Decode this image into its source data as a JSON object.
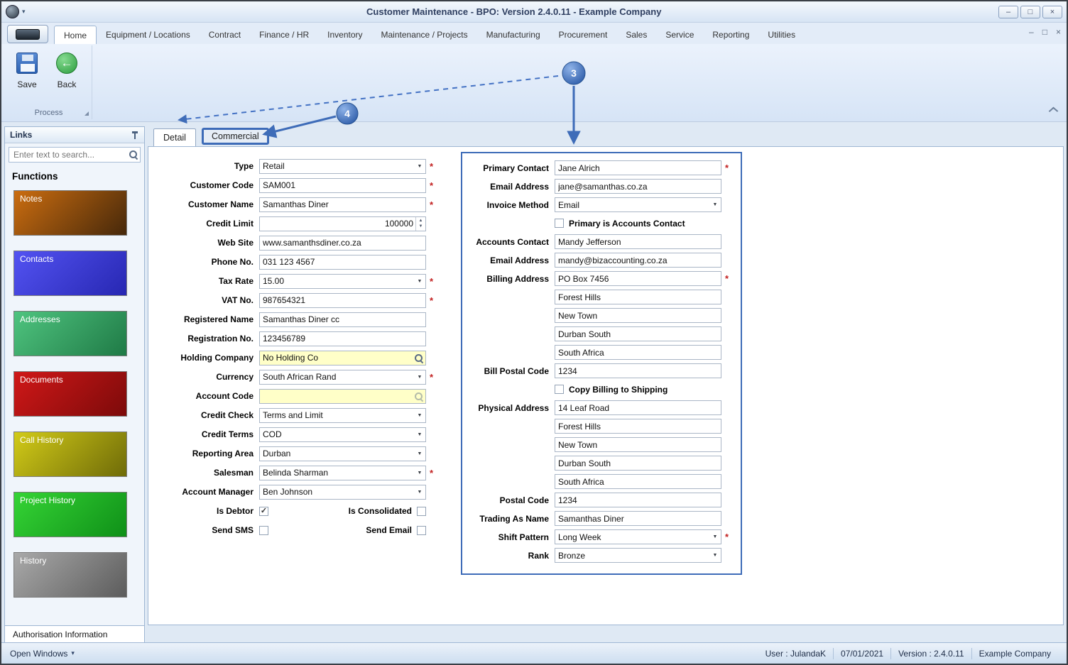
{
  "window": {
    "title": "Customer Maintenance - BPO: Version 2.4.0.11 - Example Company"
  },
  "icons": {
    "minimize": "–",
    "maximize": "□",
    "close": "×",
    "caret_down": "▾",
    "dropdown_arrow": "▼",
    "spin_up": "▲",
    "spin_down": "▼",
    "check": "✓",
    "back_arrow": "←"
  },
  "ribbon": {
    "tabs": [
      "Home",
      "Equipment / Locations",
      "Contract",
      "Finance / HR",
      "Inventory",
      "Maintenance / Projects",
      "Manufacturing",
      "Procurement",
      "Sales",
      "Service",
      "Reporting",
      "Utilities"
    ],
    "active_tab": "Home",
    "save_label": "Save",
    "back_label": "Back",
    "group_label": "Process"
  },
  "sidebar": {
    "title": "Links",
    "search_placeholder": "Enter text to search...",
    "functions_heading": "Functions",
    "items": [
      {
        "label": "Notes",
        "c1": "#cb6d10",
        "c2": "#46280a"
      },
      {
        "label": "Contacts",
        "c1": "#5353f2",
        "c2": "#2727b2"
      },
      {
        "label": "Addresses",
        "c1": "#4fc47f",
        "c2": "#1f7a46"
      },
      {
        "label": "Documents",
        "c1": "#d01818",
        "c2": "#7c0a0a"
      },
      {
        "label": "Call History",
        "c1": "#d2cb18",
        "c2": "#6f6b08"
      },
      {
        "label": "Project History",
        "c1": "#35d435",
        "c2": "#0f9018"
      },
      {
        "label": "History",
        "c1": "#a9a9a9",
        "c2": "#5c5c5c"
      }
    ],
    "footer_tab": "Authorisation Information"
  },
  "main": {
    "tabs": [
      {
        "label": "Detail"
      },
      {
        "label": "Commercial"
      }
    ],
    "left_form": [
      {
        "name": "type",
        "label": "Type",
        "value": "Retail",
        "type": "dropdown",
        "required": true
      },
      {
        "name": "customer-code",
        "label": "Customer Code",
        "value": "SAM001",
        "type": "text",
        "required": true
      },
      {
        "name": "customer-name",
        "label": "Customer Name",
        "value": "Samanthas Diner",
        "type": "text",
        "required": true
      },
      {
        "name": "credit-limit",
        "label": "Credit Limit",
        "value": "100000",
        "type": "spinner"
      },
      {
        "name": "web-site",
        "label": "Web Site",
        "value": "www.samanthsdiner.co.za",
        "type": "text"
      },
      {
        "name": "phone-no",
        "label": "Phone No.",
        "value": "031 123 4567",
        "type": "text"
      },
      {
        "name": "tax-rate",
        "label": "Tax Rate",
        "value": "15.00",
        "type": "dropdown",
        "required": true
      },
      {
        "name": "vat-no",
        "label": "VAT No.",
        "value": "987654321",
        "type": "text",
        "required": true
      },
      {
        "name": "registered-name",
        "label": "Registered Name",
        "value": "Samanthas Diner cc",
        "type": "text"
      },
      {
        "name": "registration-no",
        "label": "Registration No.",
        "value": "123456789",
        "type": "text"
      },
      {
        "name": "holding-company",
        "label": "Holding Company",
        "value": "No Holding Co",
        "type": "lookup",
        "yellow": true
      },
      {
        "name": "currency",
        "label": "Currency",
        "value": "South African Rand",
        "type": "dropdown",
        "required": true
      },
      {
        "name": "account-code",
        "label": "Account Code",
        "value": "",
        "type": "lookup",
        "yellow": true,
        "muted": true
      },
      {
        "name": "credit-check",
        "label": "Credit Check",
        "value": "Terms and Limit",
        "type": "dropdown"
      },
      {
        "name": "credit-terms",
        "label": "Credit Terms",
        "value": "COD",
        "type": "dropdown"
      },
      {
        "name": "reporting-area",
        "label": "Reporting Area",
        "value": "Durban",
        "type": "dropdown"
      },
      {
        "name": "salesman",
        "label": "Salesman",
        "value": "Belinda Sharman",
        "type": "dropdown",
        "required": true
      },
      {
        "name": "account-manager",
        "label": "Account Manager",
        "value": "Ben Johnson",
        "type": "dropdown"
      },
      {
        "name": "debtor-row",
        "type": "checkpair",
        "items": [
          {
            "name": "is-debtor",
            "label": "Is Debtor",
            "checked": true
          },
          {
            "name": "is-consolidated",
            "label": "Is Consolidated",
            "checked": false
          }
        ]
      },
      {
        "name": "sms-row",
        "type": "checkpair",
        "items": [
          {
            "name": "send-sms",
            "label": "Send SMS",
            "checked": false
          },
          {
            "name": "send-email",
            "label": "Send Email",
            "checked": false
          }
        ]
      }
    ],
    "right_form": [
      {
        "name": "primary-contact",
        "label": "Primary Contact",
        "value": "Jane Alrich",
        "type": "text",
        "required": true
      },
      {
        "name": "primary-email",
        "label": "Email Address",
        "value": "jane@samanthas.co.za",
        "type": "text"
      },
      {
        "name": "invoice-method",
        "label": "Invoice Method",
        "value": "Email",
        "type": "dropdown"
      },
      {
        "name": "primary-is-accounts-contact",
        "type": "checklabel",
        "check_label": "Primary is Accounts Contact",
        "checked": false
      },
      {
        "name": "accounts-contact",
        "label": "Accounts Contact",
        "value": "Mandy Jefferson",
        "type": "text"
      },
      {
        "name": "accounts-email",
        "label": "Email Address",
        "value": "mandy@bizaccounting.co.za",
        "type": "text"
      },
      {
        "name": "billing-address-1",
        "label": "Billing Address",
        "value": "PO Box 7456",
        "type": "text",
        "required": true
      },
      {
        "name": "billing-address-2",
        "label": "",
        "value": "Forest Hills",
        "type": "text"
      },
      {
        "name": "billing-address-3",
        "label": "",
        "value": "New Town",
        "type": "text"
      },
      {
        "name": "billing-address-4",
        "label": "",
        "value": "Durban South",
        "type": "text"
      },
      {
        "name": "billing-address-5",
        "label": "",
        "value": "South Africa",
        "type": "text"
      },
      {
        "name": "bill-postal-code",
        "label": "Bill Postal Code",
        "value": "1234",
        "type": "text"
      },
      {
        "name": "copy-billing-to-shipping",
        "type": "checklabel",
        "check_label": "Copy Billing to Shipping",
        "checked": false
      },
      {
        "name": "physical-address-1",
        "label": "Physical Address",
        "value": "14 Leaf Road",
        "type": "text"
      },
      {
        "name": "physical-address-2",
        "label": "",
        "value": "Forest Hills",
        "type": "text"
      },
      {
        "name": "physical-address-3",
        "label": "",
        "value": "New Town",
        "type": "text"
      },
      {
        "name": "physical-address-4",
        "label": "",
        "value": "Durban South",
        "type": "text"
      },
      {
        "name": "physical-address-5",
        "label": "",
        "value": "South Africa",
        "type": "text"
      },
      {
        "name": "postal-code",
        "label": "Postal Code",
        "value": "1234",
        "type": "text"
      },
      {
        "name": "trading-as-name",
        "label": "Trading As Name",
        "value": "Samanthas Diner",
        "type": "text"
      },
      {
        "name": "shift-pattern",
        "label": "Shift Pattern",
        "value": "Long Week",
        "type": "dropdown",
        "required": true
      },
      {
        "name": "rank",
        "label": "Rank",
        "value": "Bronze",
        "type": "dropdown"
      }
    ]
  },
  "statusbar": {
    "open_windows": "Open Windows",
    "segments": [
      "User : JulandaK",
      "07/01/2021",
      "Version : 2.4.0.11",
      "Example Company"
    ]
  },
  "annotations": {
    "badge_3": "3",
    "badge_4": "4",
    "accent": "#3e6cb8"
  }
}
